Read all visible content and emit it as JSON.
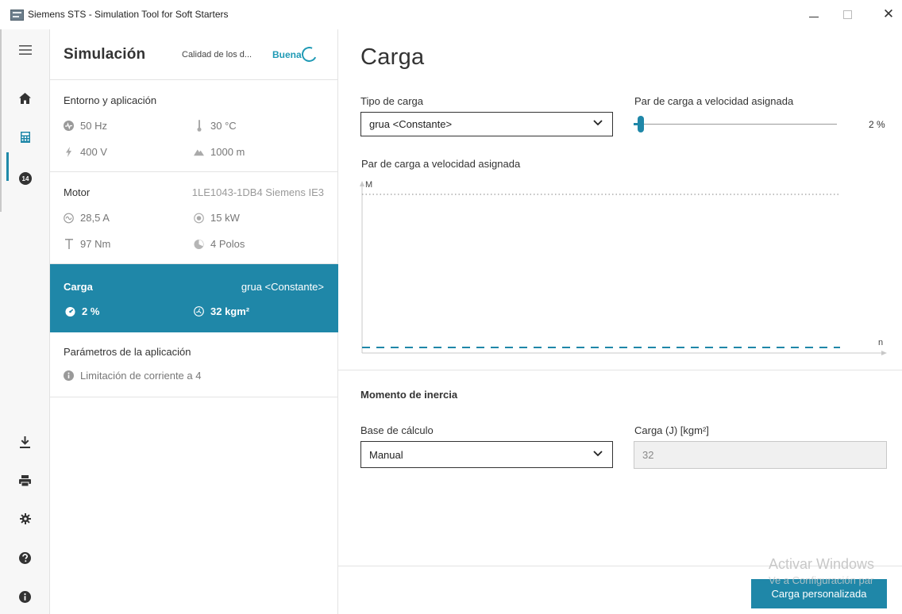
{
  "window": {
    "title": "Siemens STS - Simulation Tool for Soft Starters",
    "minimize": "",
    "maximize": "",
    "close": "✕"
  },
  "rail": {
    "items": [
      {
        "icon": "hamburger-menu-icon"
      },
      {
        "icon": "home-icon"
      },
      {
        "icon": "calculator-icon"
      },
      {
        "icon": "badge-14-icon",
        "badge": "14"
      },
      {
        "icon": "download-icon"
      },
      {
        "icon": "printer-icon"
      },
      {
        "icon": "gear-icon"
      },
      {
        "icon": "help-icon"
      },
      {
        "icon": "info-icon"
      }
    ]
  },
  "simulation": {
    "title": "Simulación",
    "quality_label": "Calidad de los d...",
    "quality_value": "Buena",
    "sections": {
      "environment": {
        "title": "Entorno y aplicación",
        "frequency": "50 Hz",
        "temperature": "30 °C",
        "voltage": "400 V",
        "altitude": "1000 m"
      },
      "motor": {
        "title": "Motor",
        "model": "1LE1043-1DB4 Siemens IE3",
        "current": "28,5 A",
        "power": "15 kW",
        "torque": "97 Nm",
        "poles": "4 Polos"
      },
      "load": {
        "title": "Carga",
        "type": "grua <Constante>",
        "torque_percent": "2 %",
        "inertia": "32 kgm²"
      },
      "application": {
        "title": "Parámetros de la aplicación",
        "current_limit": "Limitación de corriente a 4"
      }
    }
  },
  "content": {
    "title": "Carga",
    "load_type_label": "Tipo de carga",
    "load_type_value": "grua <Constante>",
    "torque_label": "Par de carga a velocidad asignada",
    "torque_value": "2 %",
    "torque_fraction": 0.02,
    "chart_title": "Par de carga a velocidad asignada",
    "inertia_heading": "Momento de inercia",
    "calc_basis_label": "Base de cálculo",
    "calc_basis_value": "Manual",
    "load_j_label": "Carga (J) [kgm²]",
    "load_j_value": "32",
    "custom_button": "Carga personalizada"
  },
  "chart_data": {
    "type": "line",
    "title": "Par de carga a velocidad asignada",
    "xlabel": "n",
    "ylabel": "M",
    "xlim": [
      0,
      1
    ],
    "ylim": [
      0,
      1
    ],
    "grid": false,
    "series": [
      {
        "x": [
          0,
          1
        ],
        "y": [
          1,
          1
        ],
        "color": "#9a9a9a",
        "style": "dotted"
      },
      {
        "x": [
          0,
          1
        ],
        "y": [
          0.02,
          0.02
        ],
        "color": "#1f87a8",
        "style": "dashed"
      }
    ]
  },
  "watermark": {
    "line1": "Activar Windows",
    "line2": "Ve a Configuración par"
  },
  "colors": {
    "accent": "#1f87a8",
    "quality": "#1f9ab5"
  }
}
